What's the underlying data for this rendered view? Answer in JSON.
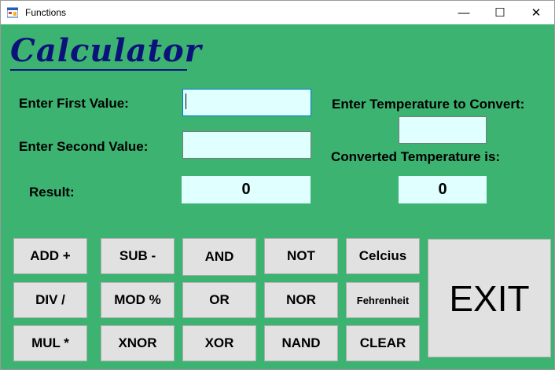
{
  "window": {
    "title": "Functions",
    "minimize": "—",
    "maximize": "☐",
    "close": "✕"
  },
  "heading": "Calculator",
  "labels": {
    "first": "Enter First Value:",
    "second": "Enter Second Value:",
    "result": "Result:",
    "temp_convert": "Enter Temperature to Convert:",
    "converted": "Converted Temperature is:"
  },
  "fields": {
    "first_value": "",
    "second_value": "",
    "temperature": ""
  },
  "outputs": {
    "result": "0",
    "converted": "0"
  },
  "buttons": {
    "add": "ADD +",
    "sub": "SUB -",
    "and": "AND",
    "not": "NOT",
    "celcius": "Celcius",
    "div": "DIV /",
    "mod": "MOD %",
    "or": "OR",
    "nor": "NOR",
    "fehrenheit": "Fehrenheit",
    "mul": "MUL *",
    "xnor": "XNOR",
    "xor": "XOR",
    "nand": "NAND",
    "clear": "CLEAR",
    "exit": "EXIT"
  },
  "colors": {
    "form_bg": "#3cb371",
    "field_bg": "#e0ffff",
    "heading": "#0b137a",
    "button_bg": "#e1e1e1"
  }
}
